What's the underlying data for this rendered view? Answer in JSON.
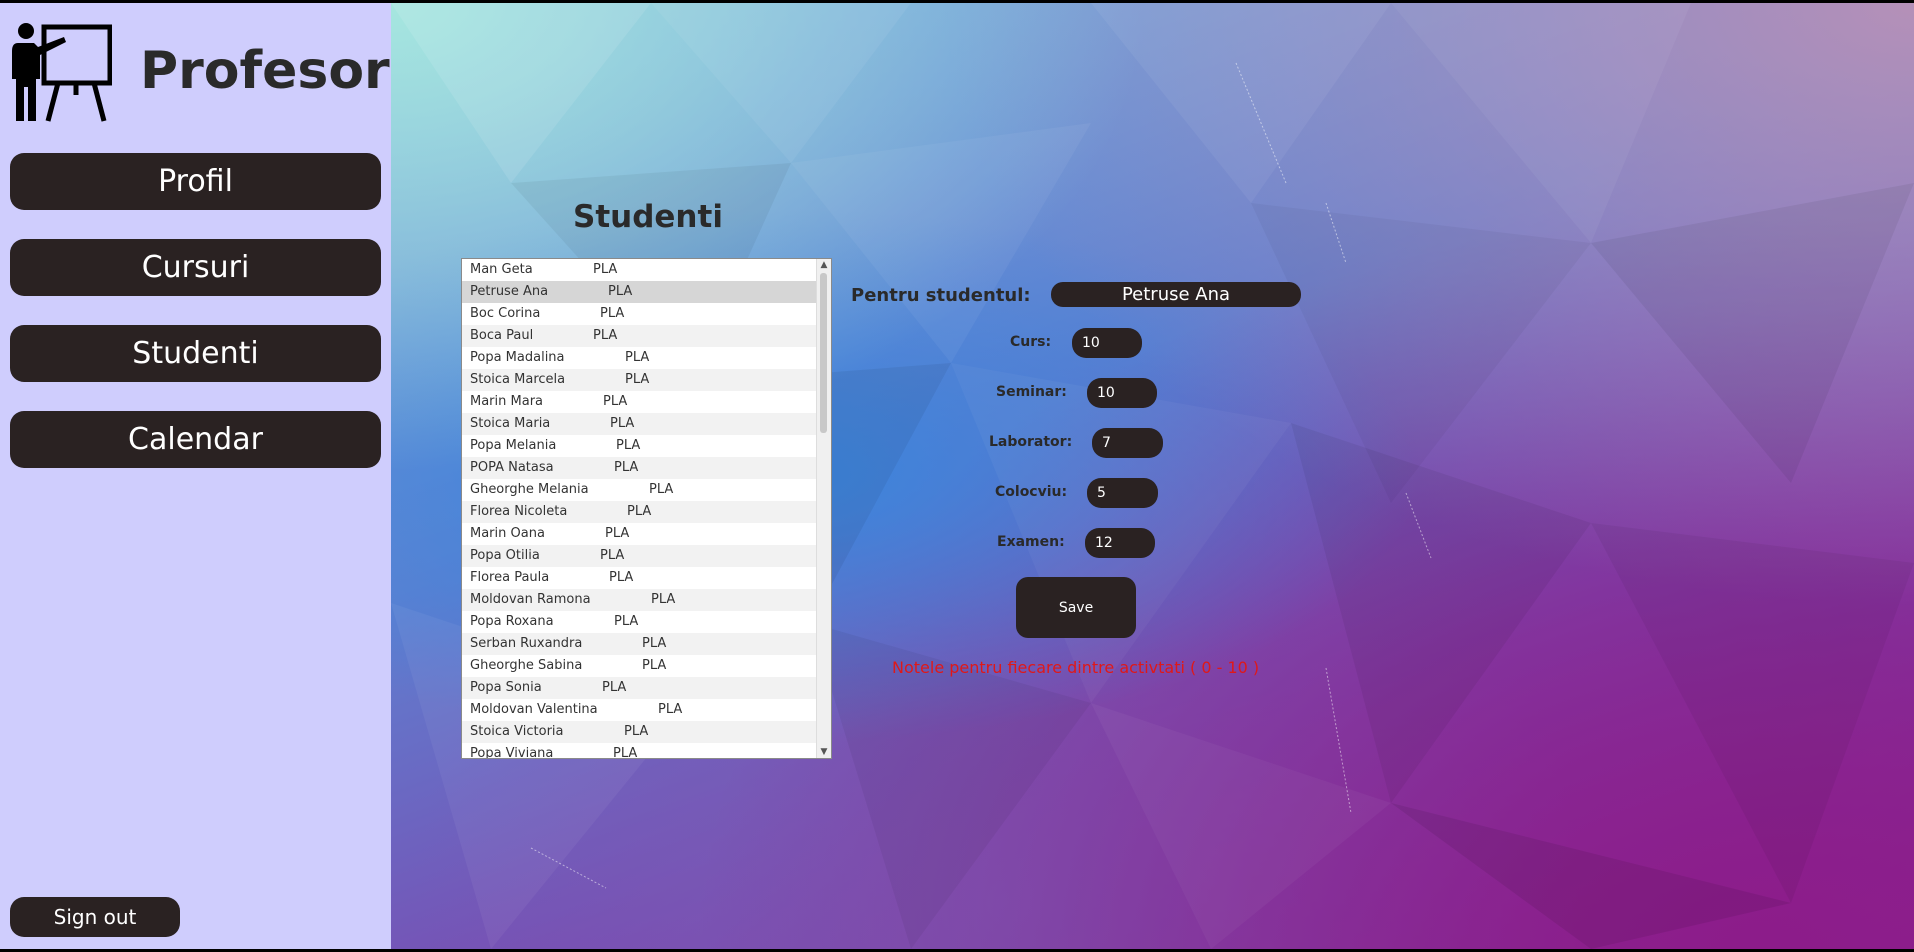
{
  "app": {
    "title": "Profesor"
  },
  "nav": {
    "items": [
      {
        "label": "Profil"
      },
      {
        "label": "Cursuri"
      },
      {
        "label": "Studenti"
      },
      {
        "label": "Calendar"
      }
    ],
    "signout_label": "Sign out"
  },
  "students": {
    "title": "Studenti",
    "selected_index": 1,
    "rows": [
      {
        "name": "Man Geta",
        "group": "PLA"
      },
      {
        "name": "Petruse Ana",
        "group": "PLA"
      },
      {
        "name": "Boc Corina",
        "group": "PLA"
      },
      {
        "name": "Boca Paul",
        "group": "PLA"
      },
      {
        "name": "Popa Madalina",
        "group": "PLA"
      },
      {
        "name": "Stoica Marcela",
        "group": "PLA"
      },
      {
        "name": "Marin Mara",
        "group": "PLA"
      },
      {
        "name": "Stoica Maria",
        "group": "PLA"
      },
      {
        "name": "Popa Melania",
        "group": "PLA"
      },
      {
        "name": "POPA Natasa",
        "group": "PLA"
      },
      {
        "name": "Gheorghe Melania",
        "group": "PLA"
      },
      {
        "name": "Florea Nicoleta",
        "group": "PLA"
      },
      {
        "name": "Marin Oana",
        "group": "PLA"
      },
      {
        "name": "Popa Otilia",
        "group": "PLA"
      },
      {
        "name": "Florea Paula",
        "group": "PLA"
      },
      {
        "name": "Moldovan Ramona",
        "group": "PLA"
      },
      {
        "name": "Popa Roxana",
        "group": "PLA"
      },
      {
        "name": "Serban Ruxandra",
        "group": "PLA"
      },
      {
        "name": "Gheorghe Sabina",
        "group": "PLA"
      },
      {
        "name": "Popa Sonia",
        "group": "PLA"
      },
      {
        "name": "Moldovan Valentina",
        "group": "PLA"
      },
      {
        "name": "Stoica Victoria",
        "group": "PLA"
      },
      {
        "name": "Popa Viviana",
        "group": "PLA"
      }
    ]
  },
  "grades": {
    "student_label": "Pentru studentul:",
    "student_value": "Petruse Ana",
    "curs_label": "Curs:",
    "curs_value": "10",
    "seminar_label": "Seminar:",
    "seminar_value": "10",
    "laborator_label": "Laborator:",
    "laborator_value": "7",
    "colocviu_label": "Colocviu:",
    "colocviu_value": "5",
    "examen_label": "Examen:",
    "examen_value": "12",
    "save_label": "Save",
    "hint": "Notele pentru fiecare dintre activtati ( 0 - 10 )"
  },
  "colors": {
    "sidebar_bg": "#cfcdfd",
    "button_bg": "#2a2222",
    "hint_color": "#e01818"
  },
  "icons": {
    "logo": "teacher-board-icon"
  }
}
